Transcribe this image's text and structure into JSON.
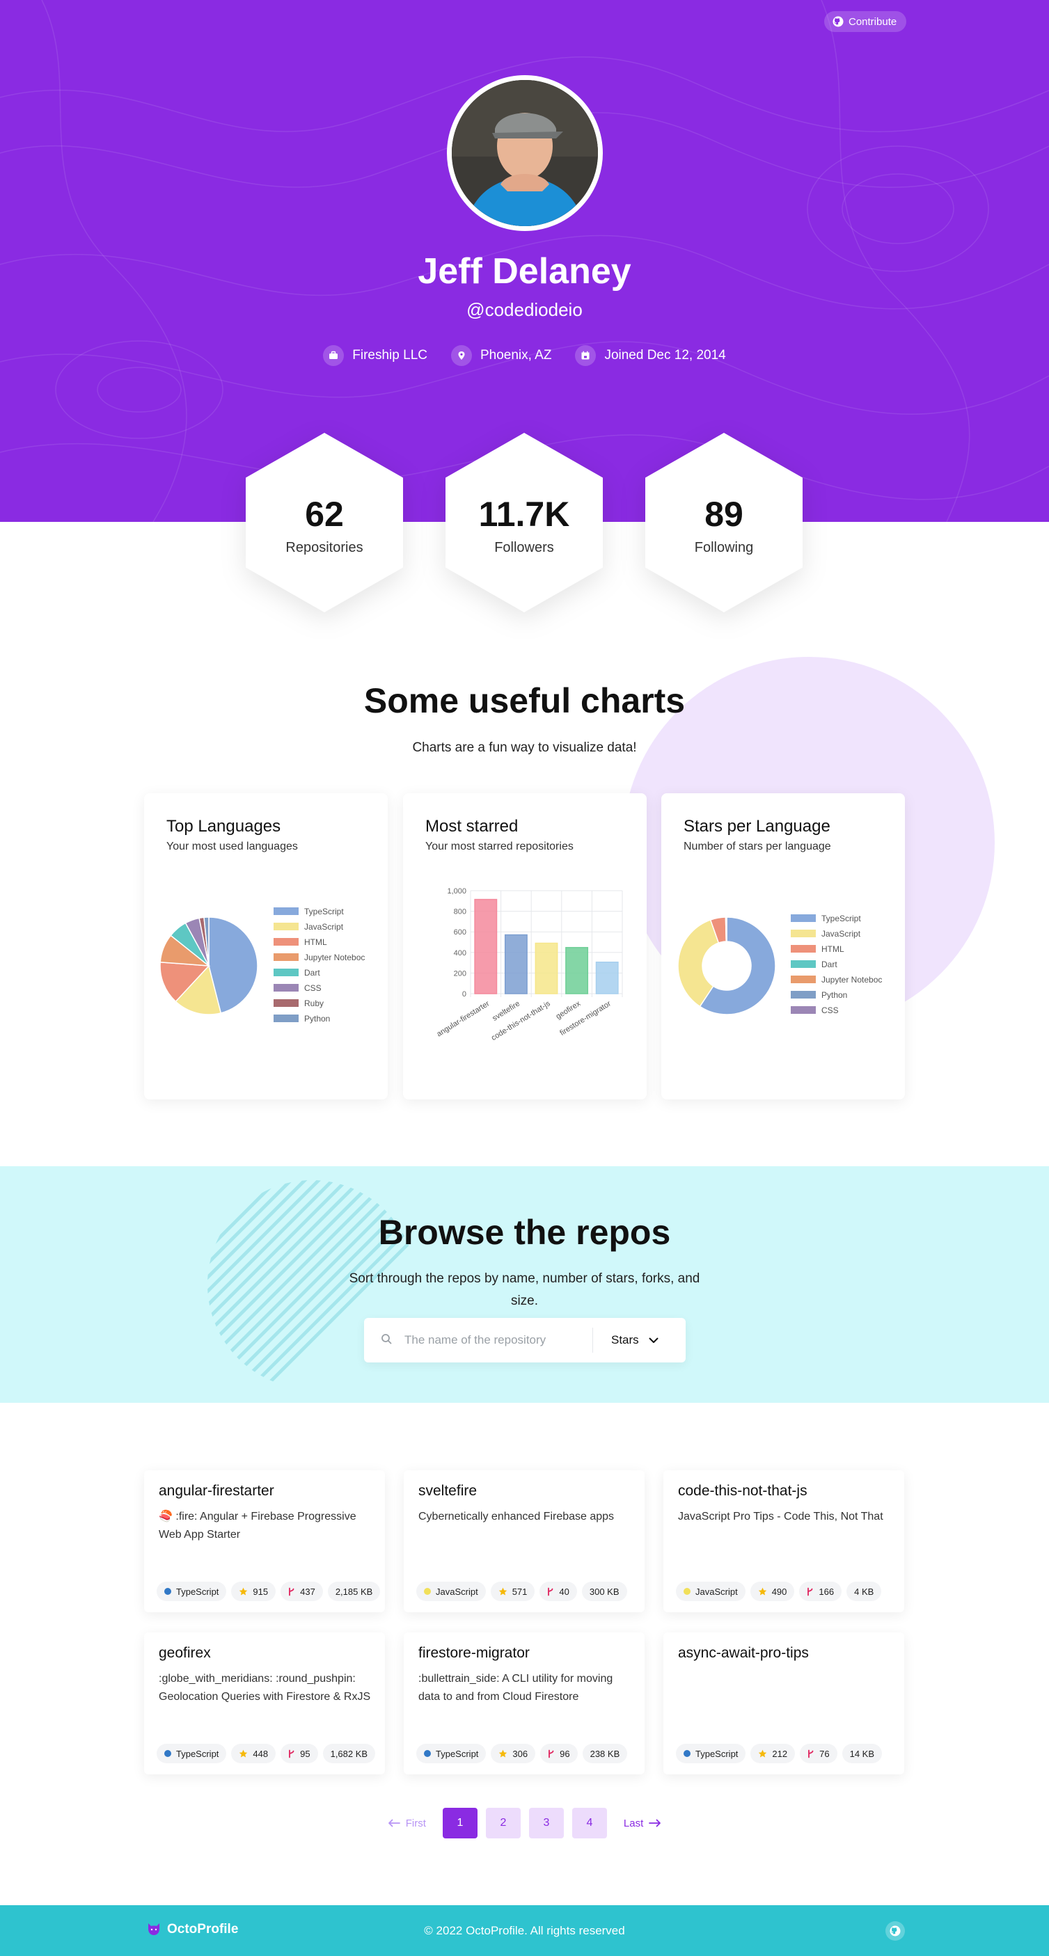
{
  "header": {
    "contribute_label": "Contribute",
    "name": "Jeff Delaney",
    "handle": "@codediodeio",
    "meta": [
      {
        "icon": "briefcase-icon",
        "text": "Fireship LLC"
      },
      {
        "icon": "location-pin-icon",
        "text": "Phoenix, AZ"
      },
      {
        "icon": "calendar-icon",
        "text": "Joined Dec 12, 2014"
      }
    ],
    "brand_color": "#8a2be2"
  },
  "stats": [
    {
      "value": "62",
      "label": "Repositories"
    },
    {
      "value": "11.7K",
      "label": "Followers"
    },
    {
      "value": "89",
      "label": "Following"
    }
  ],
  "charts_section": {
    "title": "Some useful charts",
    "subtitle": "Charts are a fun way to visualize data!"
  },
  "chart_data": [
    {
      "type": "pie",
      "title": "Top Languages",
      "subtitle": "Your most used languages",
      "labels": [
        "TypeScript",
        "JavaScript",
        "HTML",
        "Jupyter Noteboc",
        "Dart",
        "CSS",
        "Ruby",
        "Python"
      ],
      "values": [
        29,
        10,
        9,
        6,
        4,
        3,
        1,
        1
      ],
      "colors": [
        "#87a9dc",
        "#f5e591",
        "#ee917a",
        "#e99b6c",
        "#5ec7c3",
        "#9b86b5",
        "#a86a6e",
        "#7f9ec6"
      ]
    },
    {
      "type": "bar",
      "title": "Most starred",
      "subtitle": "Your most starred repositories",
      "categories": [
        "angular-firestarter",
        "sveltefire",
        "code-this-not-that-js",
        "geofirex",
        "firestore-migrator"
      ],
      "values": [
        915,
        571,
        490,
        448,
        306
      ],
      "ylim": [
        0,
        1000
      ],
      "yticks": [
        "0",
        "200",
        "400",
        "600",
        "800",
        "1,000"
      ],
      "colors": [
        "#f4899c",
        "#7d9fd1",
        "#f6e68a",
        "#6fcf97",
        "#a6cfee"
      ]
    },
    {
      "type": "pie",
      "title": "Stars per Language",
      "subtitle": "Number of stars per language",
      "labels": [
        "TypeScript",
        "JavaScript",
        "HTML",
        "Dart",
        "Jupyter Noteboc",
        "Python",
        "CSS"
      ],
      "values": [
        2350,
        1400,
        200,
        5,
        4,
        3,
        2
      ],
      "colors": [
        "#87a9dc",
        "#f5e591",
        "#ee917a",
        "#5ec7c3",
        "#e99b6c",
        "#7f9ec6",
        "#9b86b5"
      ]
    }
  ],
  "browse": {
    "title": "Browse the repos",
    "subtitle": "Sort through the repos by name, number of stars, forks, and size.",
    "search_placeholder": "The name of the repository",
    "sort_value": "Stars"
  },
  "repos": [
    {
      "name": "angular-firestarter",
      "desc": "🍣 :fire: Angular + Firebase Progressive Web App Starter",
      "lang": "TypeScript",
      "lang_color": "#3178c6",
      "stars": "915",
      "forks": "437",
      "size": "2,185 KB"
    },
    {
      "name": "sveltefire",
      "desc": "Cybernetically enhanced Firebase apps",
      "lang": "JavaScript",
      "lang_color": "#f1e05a",
      "stars": "571",
      "forks": "40",
      "size": "300 KB"
    },
    {
      "name": "code-this-not-that-js",
      "desc": "JavaScript Pro Tips - Code This, Not That",
      "lang": "JavaScript",
      "lang_color": "#f1e05a",
      "stars": "490",
      "forks": "166",
      "size": "4 KB"
    },
    {
      "name": "geofirex",
      "desc": ":globe_with_meridians: :round_pushpin: Geolocation Queries with Firestore & RxJS",
      "lang": "TypeScript",
      "lang_color": "#3178c6",
      "stars": "448",
      "forks": "95",
      "size": "1,682 KB"
    },
    {
      "name": "firestore-migrator",
      "desc": ":bullettrain_side: A CLI utility for moving data to and from Cloud Firestore",
      "lang": "TypeScript",
      "lang_color": "#3178c6",
      "stars": "306",
      "forks": "96",
      "size": "238 KB"
    },
    {
      "name": "async-await-pro-tips",
      "desc": "",
      "lang": "TypeScript",
      "lang_color": "#3178c6",
      "stars": "212",
      "forks": "76",
      "size": "14 KB"
    }
  ],
  "pagination": {
    "first_label": "First",
    "last_label": "Last",
    "pages": [
      "1",
      "2",
      "3",
      "4"
    ],
    "current": "1"
  },
  "footer": {
    "brand": "OctoProfile",
    "copyright": "© 2022 OctoProfile. All rights reserved"
  }
}
